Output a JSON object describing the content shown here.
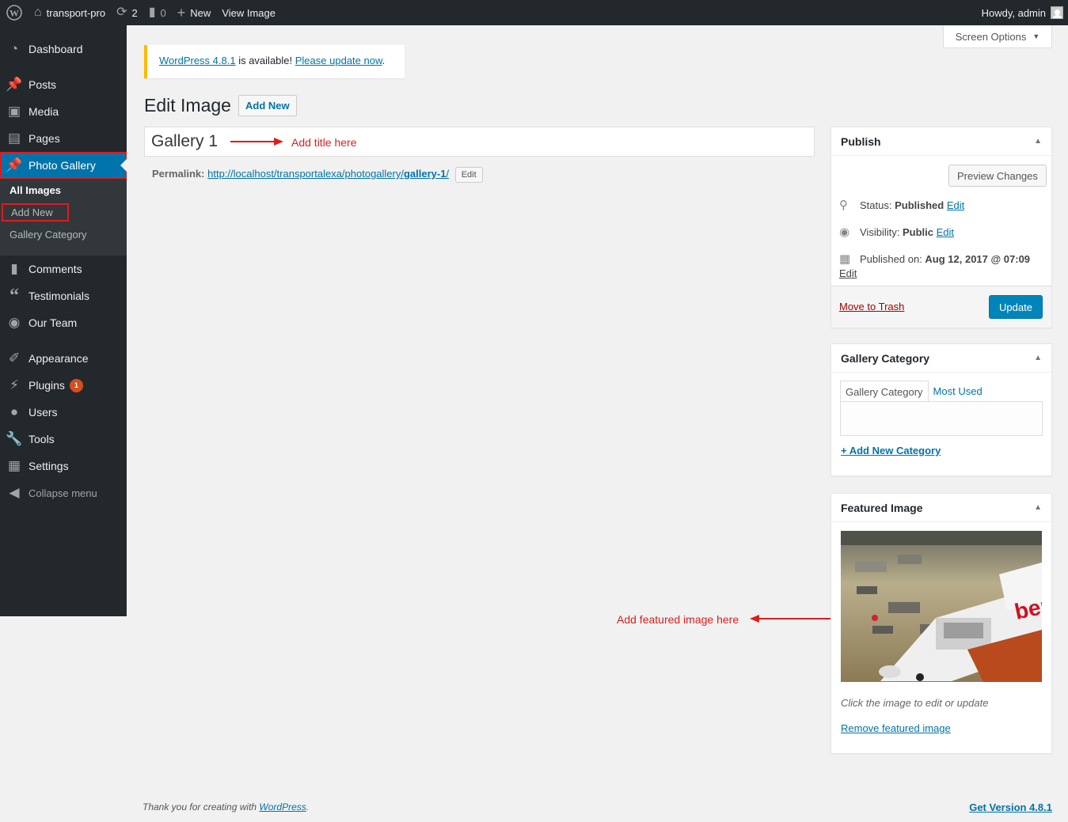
{
  "adminbar": {
    "site_name": "transport-pro",
    "updates_count": "2",
    "comments_count": "0",
    "new_label": "New",
    "view_label": "View Image",
    "howdy": "Howdy, admin"
  },
  "sidebar": {
    "items": [
      {
        "label": "Dashboard",
        "icon": "dashboard-icon"
      },
      {
        "label": "Posts",
        "icon": "pin-icon"
      },
      {
        "label": "Media",
        "icon": "media-icon"
      },
      {
        "label": "Pages",
        "icon": "pages-icon"
      },
      {
        "label": "Photo Gallery",
        "icon": "pin-icon"
      },
      {
        "label": "Comments",
        "icon": "comment-icon"
      },
      {
        "label": "Testimonials",
        "icon": "quote-icon"
      },
      {
        "label": "Our Team",
        "icon": "group-icon"
      },
      {
        "label": "Appearance",
        "icon": "brush-icon"
      },
      {
        "label": "Plugins",
        "icon": "plugin-icon"
      },
      {
        "label": "Users",
        "icon": "user-icon"
      },
      {
        "label": "Tools",
        "icon": "wrench-icon"
      },
      {
        "label": "Settings",
        "icon": "settings-icon"
      }
    ],
    "plugins_badge": "1",
    "submenu": [
      "All Images",
      "Add New",
      "Gallery Category"
    ],
    "collapse": "Collapse menu"
  },
  "screen_options": "Screen Options",
  "notice": {
    "version_link": "WordPress 4.8.1",
    "text": " is available! ",
    "update_link": "Please update now",
    "period": "."
  },
  "page": {
    "title": "Edit Image",
    "add_new": "Add New",
    "post_title": "Gallery 1",
    "annotation_title": "Add title here",
    "permalink_label": "Permalink:",
    "permalink_base": "http://localhost/transportalexa/photogallery/",
    "permalink_slug": "gallery-1",
    "permalink_end": "/",
    "permalink_edit": "Edit",
    "annotation_featured": "Add featured image here"
  },
  "publish": {
    "title": "Publish",
    "preview": "Preview Changes",
    "status_label": "Status:",
    "status_value": "Published",
    "visibility_label": "Visibility:",
    "visibility_value": "Public",
    "published_label": "Published on:",
    "published_value": "Aug 12, 2017 @ 07:09",
    "edit": "Edit",
    "trash": "Move to Trash",
    "update": "Update"
  },
  "gallery_category": {
    "title": "Gallery Category",
    "tab_all": "Gallery Category",
    "tab_most_used": "Most Used",
    "add_new": "+ Add New Category"
  },
  "featured_image": {
    "title": "Featured Image",
    "hint": "Click the image to edit or update",
    "remove": "Remove featured image",
    "image_text": "berlin"
  },
  "footer": {
    "thanks": "Thank you for creating with ",
    "wp_link": "WordPress",
    "period": ".",
    "version": "Get Version 4.8.1"
  },
  "colors": {
    "accent": "#0073aa",
    "highlight": "#dd1d1d",
    "sidebar": "#23282d"
  }
}
